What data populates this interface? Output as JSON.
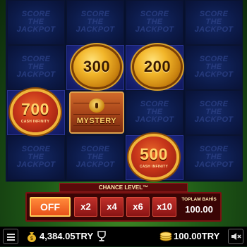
{
  "reels": {
    "watermark_line1": "SCORE",
    "watermark_line2": "THE JACKPOT",
    "coins": [
      {
        "value": "300",
        "style": "gold"
      },
      {
        "value": "200",
        "style": "gold"
      },
      {
        "value": "700",
        "style": "red",
        "sub": "CASH INFINITY"
      },
      {
        "value": "500",
        "style": "red",
        "sub": "CASH INFINITY"
      }
    ],
    "mystery_label": "MYSTERY"
  },
  "chance": {
    "title": "CHANCE LEVEL™",
    "options": [
      "OFF",
      "x2",
      "x4",
      "x6",
      "x10"
    ],
    "selected": "OFF",
    "total_label": "TOPLAM BAHİS",
    "total_value": "100.00"
  },
  "bottom_bar": {
    "balance": "4,384.05TRY",
    "bet": "100.00TRY",
    "icons": [
      "menu-icon",
      "money-bag-icon",
      "trophy-icon",
      "coins-icon",
      "sound-icon"
    ]
  },
  "colors": {
    "reel_background": "#06102e",
    "panel_red": "#8a1414",
    "off_orange": "#e8501a",
    "gold": "#f2b62a"
  }
}
